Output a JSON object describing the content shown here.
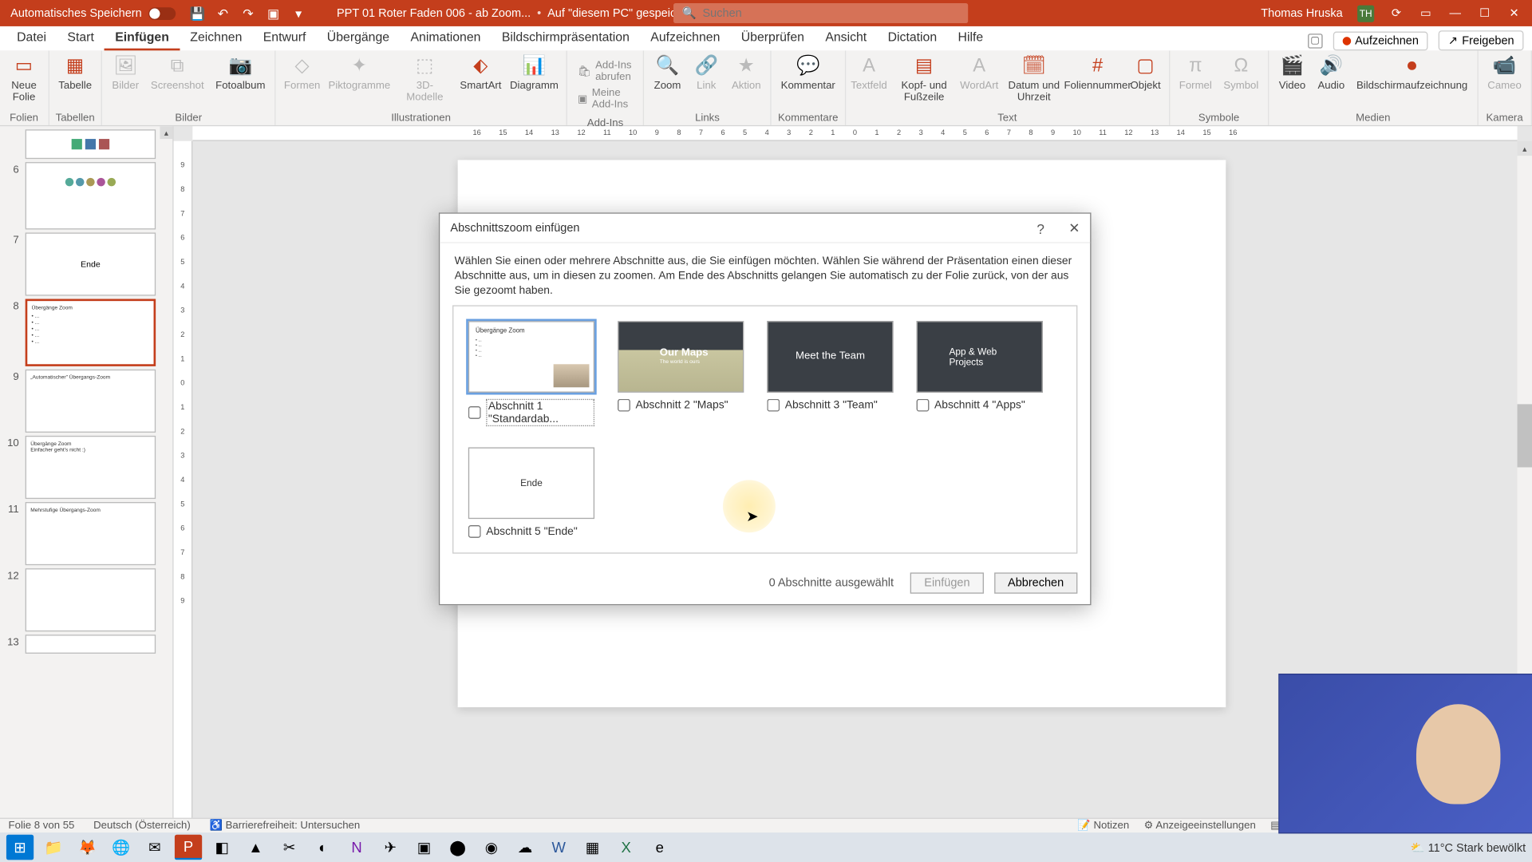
{
  "titlebar": {
    "autosave": "Automatisches Speichern",
    "docname": "PPT 01 Roter Faden 006 - ab Zoom...",
    "saved_state": "Auf \"diesem PC\" gespeichert",
    "search_placeholder": "Suchen",
    "username": "Thomas Hruska",
    "user_initials": "TH"
  },
  "tabs": {
    "datei": "Datei",
    "start": "Start",
    "einfuegen": "Einfügen",
    "zeichnen": "Zeichnen",
    "entwurf": "Entwurf",
    "uebergaenge": "Übergänge",
    "animationen": "Animationen",
    "bildschirm": "Bildschirmpräsentation",
    "aufzeichnen": "Aufzeichnen",
    "ueberpruefen": "Überprüfen",
    "ansicht": "Ansicht",
    "dictation": "Dictation",
    "hilfe": "Hilfe",
    "record_btn": "Aufzeichnen",
    "share_btn": "Freigeben"
  },
  "ribbon": {
    "g_folien": "Folien",
    "neue_folie": "Neue Folie",
    "g_tabellen": "Tabellen",
    "tabelle": "Tabelle",
    "g_bilder": "Bilder",
    "bilder": "Bilder",
    "screenshot": "Screenshot",
    "fotoalbum": "Fotoalbum",
    "g_illu": "Illustrationen",
    "formen": "Formen",
    "piktogramme": "Piktogramme",
    "modelle3d": "3D-Modelle",
    "smartart": "SmartArt",
    "diagramm": "Diagramm",
    "g_addins": "Add-Ins",
    "addins_get": "Add-Ins abrufen",
    "addins_my": "Meine Add-Ins",
    "g_links": "Links",
    "zoom": "Zoom",
    "link": "Link",
    "aktion": "Aktion",
    "g_kommentare": "Kommentare",
    "kommentar": "Kommentar",
    "g_text": "Text",
    "textfeld": "Textfeld",
    "kopf": "Kopf- und Fußzeile",
    "wordart": "WordArt",
    "datum": "Datum und Uhrzeit",
    "foliennummer": "Foliennummer",
    "objekt": "Objekt",
    "g_symbole": "Symbole",
    "formel": "Formel",
    "symbol": "Symbol",
    "g_medien": "Medien",
    "video": "Video",
    "audio": "Audio",
    "bildaufz": "Bildschirmaufzeichnung",
    "g_kamera": "Kamera",
    "cameo": "Cameo"
  },
  "thumbs": {
    "n6": "6",
    "n7": "7",
    "t7": "Ende",
    "n8": "8",
    "t8": "Übergänge Zoom",
    "n9": "9",
    "t9": "„Automatischer\" Übergangs-Zoom",
    "n10": "10",
    "t10": "Übergänge Zoom",
    "n11": "11",
    "t11": "Mehrstufige Übergangs-Zoom",
    "n12": "12",
    "n13": "13"
  },
  "ruler": [
    "16",
    "15",
    "14",
    "13",
    "12",
    "11",
    "10",
    "9",
    "8",
    "7",
    "6",
    "5",
    "4",
    "3",
    "2",
    "1",
    "0",
    "1",
    "2",
    "3",
    "4",
    "5",
    "6",
    "7",
    "8",
    "9",
    "10",
    "11",
    "12",
    "13",
    "14",
    "15",
    "16"
  ],
  "ruler_v": [
    "9",
    "8",
    "7",
    "6",
    "5",
    "4",
    "3",
    "2",
    "1",
    "0",
    "1",
    "2",
    "3",
    "4",
    "5",
    "6",
    "7",
    "8",
    "9"
  ],
  "dialog": {
    "title": "Abschnittszoom einfügen",
    "desc": "Wählen Sie einen oder mehrere Abschnitte aus, die Sie einfügen möchten. Wählen Sie während der Präsentation einen dieser Abschnitte aus, um in diesen zu zoomen. Am Ende des Abschnitts gelangen Sie automatisch zu der Folie zurück, von der aus Sie gezoomt haben.",
    "s1": "Abschnitt 1 \"Standardab...",
    "s2": "Abschnitt 2 \"Maps\"",
    "s3": "Abschnitt 3 \"Team\"",
    "s4": "Abschnitt 4 \"Apps\"",
    "s5": "Abschnitt 5 \"Ende\"",
    "s1_thumb": "Übergänge Zoom",
    "s2_thumb": "Our Maps",
    "s2_sub": "The world is ours",
    "s3_thumb": "Meet the Team",
    "s4_thumb": "App & Web Projects",
    "s5_thumb": "Ende",
    "count": "0 Abschnitte ausgewählt",
    "insert": "Einfügen",
    "cancel": "Abbrechen"
  },
  "status": {
    "slide": "Folie 8 von 55",
    "lang": "Deutsch (Österreich)",
    "access": "Barrierefreiheit: Untersuchen",
    "notes": "Notizen",
    "display": "Anzeigeeinstellungen"
  },
  "taskbar": {
    "weather": "11°C  Stark bewölkt"
  }
}
